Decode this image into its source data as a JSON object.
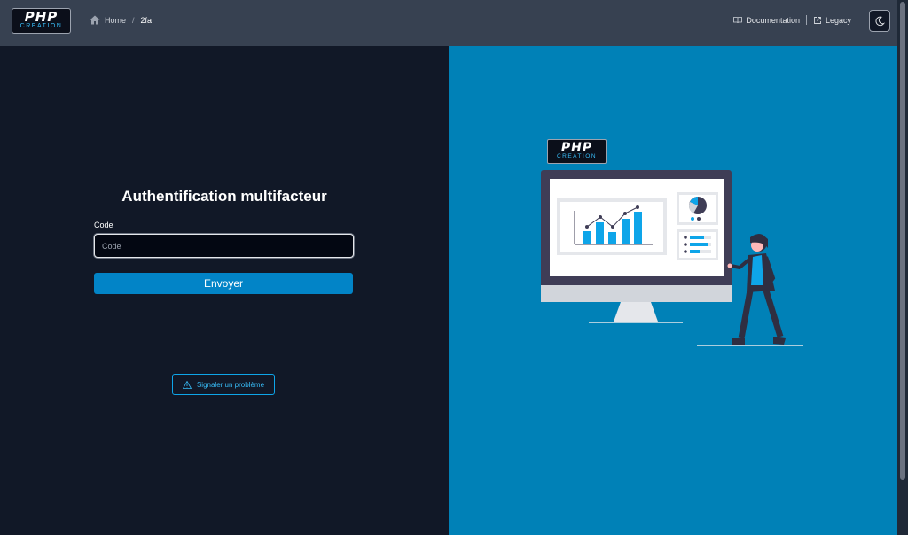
{
  "header": {
    "logo": {
      "main": "PHP",
      "sub": "CREATION"
    },
    "breadcrumb": {
      "home": "Home",
      "separator": "/",
      "current": "2fa"
    },
    "links": {
      "documentation": "Documentation",
      "legacy": "Legacy"
    },
    "theme_toggle_icon": "moon-icon"
  },
  "form": {
    "title": "Authentification multifacteur",
    "code_label": "Code",
    "code_placeholder": "Code",
    "code_value": "",
    "submit_label": "Envoyer",
    "report_label": "Signaler un problème",
    "report_icon": "warning-triangle-icon"
  },
  "illustration": {
    "logo": {
      "main": "PHP",
      "sub": "CREATION"
    },
    "description_icon": "dashboard-presentation-illustration"
  },
  "colors": {
    "header_bg": "#374151",
    "left_bg": "#111827",
    "right_bg": "#0081b7",
    "accent": "#0284c7"
  }
}
